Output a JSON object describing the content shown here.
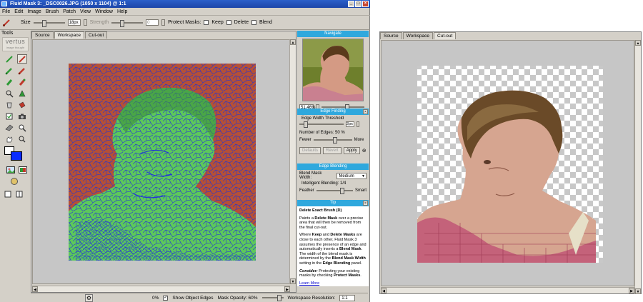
{
  "window": {
    "title": "Fluid Mask 3: _DSC0026.JPG (1050 x 1104) @ 1:1",
    "controls": [
      "_",
      "□",
      "×"
    ]
  },
  "menu": [
    "File",
    "Edit",
    "Image",
    "Brush",
    "Patch",
    "View",
    "Window",
    "Help"
  ],
  "tool_options": {
    "size_label": "Size",
    "size_value": "18px",
    "strength_label": "Strength",
    "strength_value": "0",
    "protect_label": "Protect Masks:",
    "keep_label": "Keep",
    "delete_label": "Delete",
    "blend_label": "Blend"
  },
  "toolbox": {
    "title": "Tools",
    "logo_text": "vertus",
    "logo_sub": "image thought",
    "tools": [
      "keep-brush",
      "delete-brush",
      "keep-exact-brush",
      "delete-exact-brush",
      "keep-local-brush",
      "blend-brush",
      "magnify-tool",
      "patch-tool",
      "fill-tool",
      "bucket-tool",
      "check-tool",
      "camera-tool",
      "eraser-tool",
      "zoom-tool",
      "hand-tool",
      "magnifier-tool"
    ],
    "fg_color": "#ffffff",
    "bg_color": "#0a2bff"
  },
  "workspace": {
    "tabs": [
      "Source",
      "Workspace",
      "Cut-out"
    ],
    "active_tab": "Workspace"
  },
  "statusbar": {
    "progress": "0%",
    "show_edges_label": "Show Object Edges",
    "mask_opacity_label": "Mask Opacity: 60%",
    "resolution_label": "Workspace Resolution:",
    "resolution_value": "1:1"
  },
  "navigate": {
    "title": "Navigate",
    "zoom": "51.46%"
  },
  "edge_finding": {
    "title": "Edge Finding",
    "threshold_label": "Edge Width Threshold",
    "threshold_value": "2px",
    "edges_label": "Number of Edges:",
    "edges_value": "50 %",
    "fewer_label": "Fewer",
    "more_label": "More",
    "btn_defaults": "Defaults",
    "btn_revert": "Revert",
    "btn_apply": "Apply"
  },
  "edge_blending": {
    "title": "Edge Blending",
    "width_label": "Blend Mask Width:",
    "width_value": "Medium",
    "intelligent_label": "Intelligent Blending:",
    "intelligent_value": "1/4",
    "feather_label": "Feather",
    "smart_label": "Smart"
  },
  "tip": {
    "title": "Tip",
    "heading": "Delete Exact Brush (D)",
    "p1_a": "Paints a ",
    "p1_b": "Delete Mask",
    "p1_c": " over a precise area that will then be removed from the final cut-out.",
    "p2_a": "Where ",
    "p2_b": "Keep",
    "p2_c": " and ",
    "p2_d": "Delete Masks",
    "p2_e": " are close to each other, Fluid Mask 3 assumes the presence of an edge and automatically inserts a ",
    "p2_f": "Blend Mask",
    "p2_g": ". The width of the blend mask is determined by the ",
    "p2_h": "Blend Mask Width",
    "p2_i": " setting in the ",
    "p2_j": "Edge Blending",
    "p2_k": " panel.",
    "p3_a": "Consider:",
    "p3_b": " Protecting your existing masks by checking ",
    "p3_c": "Protect Masks",
    "p3_d": ".",
    "link": "Learn More"
  },
  "cutout_window": {
    "tabs": [
      "Source",
      "Workspace",
      "Cut-out"
    ],
    "active_tab": "Cut-out"
  }
}
